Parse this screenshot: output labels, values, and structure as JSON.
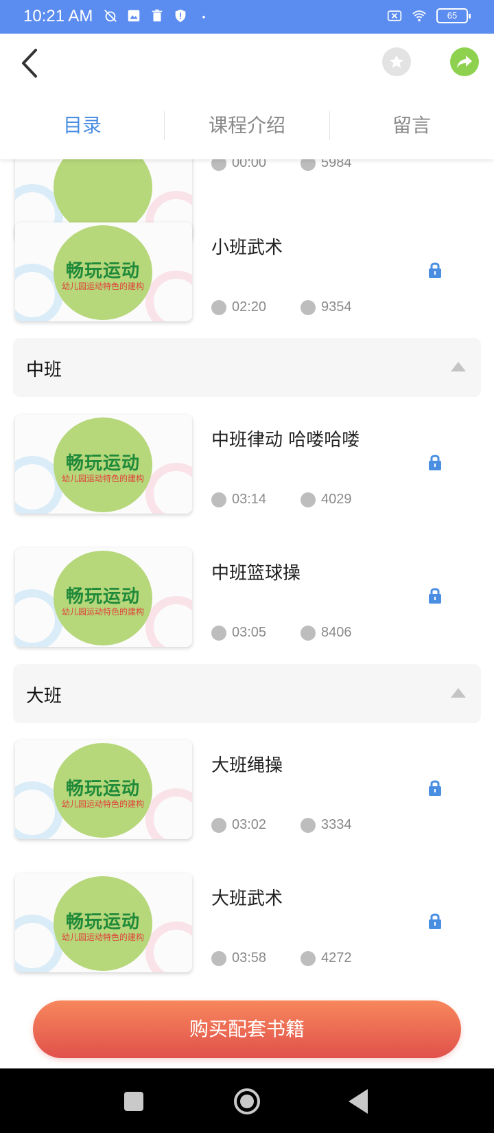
{
  "status_bar": {
    "time": "10:21 AM",
    "battery": "65"
  },
  "tabs": [
    {
      "label": "目录",
      "active": true
    },
    {
      "label": "课程介绍",
      "active": false
    },
    {
      "label": "留言",
      "active": false
    }
  ],
  "thumbnail": {
    "brand": "畅玩运动",
    "slogan": "幼儿园运动特色的建构"
  },
  "items": [
    {
      "title": "",
      "duration": "00:00",
      "plays": "5984",
      "locked": false
    },
    {
      "title": "小班武术",
      "duration": "02:20",
      "plays": "9354",
      "locked": true
    },
    {
      "title": "中班律动 哈喽哈喽",
      "duration": "03:14",
      "plays": "4029",
      "locked": true
    },
    {
      "title": "中班篮球操",
      "duration": "03:05",
      "plays": "8406",
      "locked": true
    },
    {
      "title": "大班绳操",
      "duration": "03:02",
      "plays": "3334",
      "locked": true
    },
    {
      "title": "大班武术",
      "duration": "03:58",
      "plays": "4272",
      "locked": true
    }
  ],
  "sections": [
    {
      "label": "中班"
    },
    {
      "label": "大班"
    }
  ],
  "buy_button": {
    "label": "购买配套书籍"
  },
  "colors": {
    "status_bar": "#5b8cf0",
    "active_tab": "#4a8ee2",
    "lock": "#4a8ee2",
    "share": "#8dd14e",
    "buy_start": "#f7875c",
    "buy_end": "#e0514b"
  }
}
